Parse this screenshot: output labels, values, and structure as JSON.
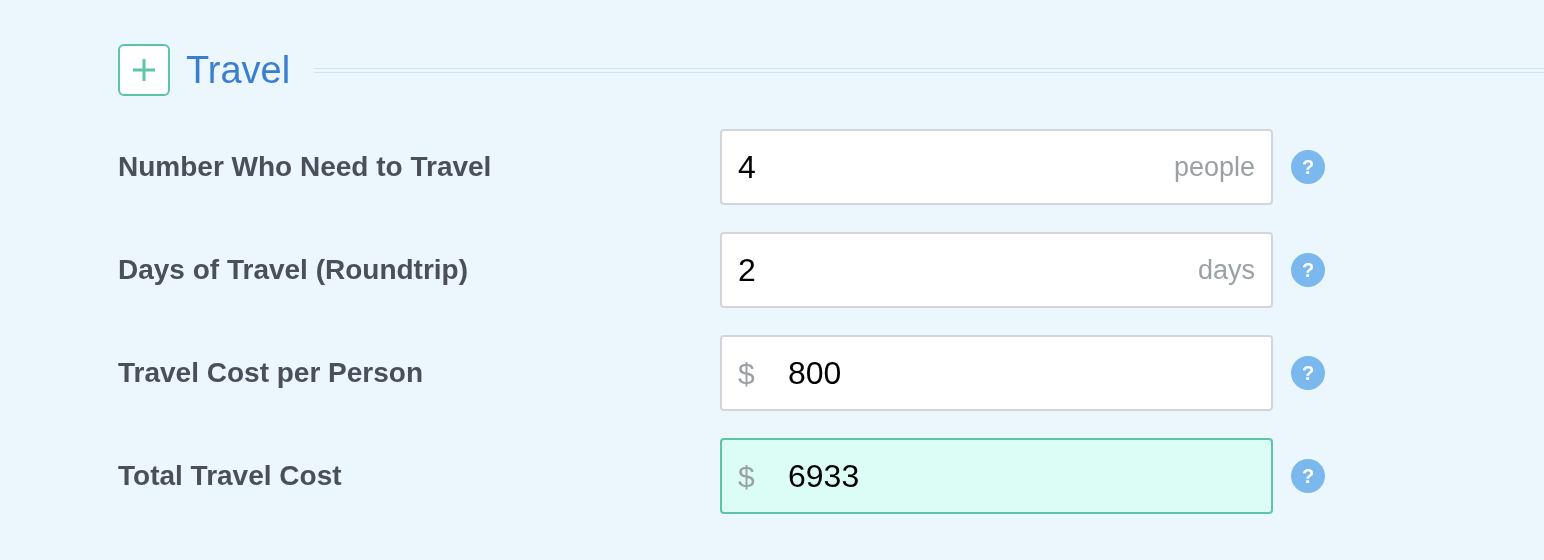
{
  "section": {
    "title": "Travel",
    "expanded": false
  },
  "fields": [
    {
      "label": "Number Who Need to Travel",
      "kind": "unit",
      "value": "4",
      "unit": "people",
      "computed": false
    },
    {
      "label": "Days of Travel (Roundtrip)",
      "kind": "unit",
      "value": "2",
      "unit": "days",
      "computed": false
    },
    {
      "label": "Travel Cost per Person",
      "kind": "currency",
      "value": "800",
      "symbol": "$",
      "computed": false
    },
    {
      "label": "Total Travel Cost",
      "kind": "currency",
      "value": "6933",
      "symbol": "$",
      "computed": true
    }
  ],
  "help_label": "?"
}
